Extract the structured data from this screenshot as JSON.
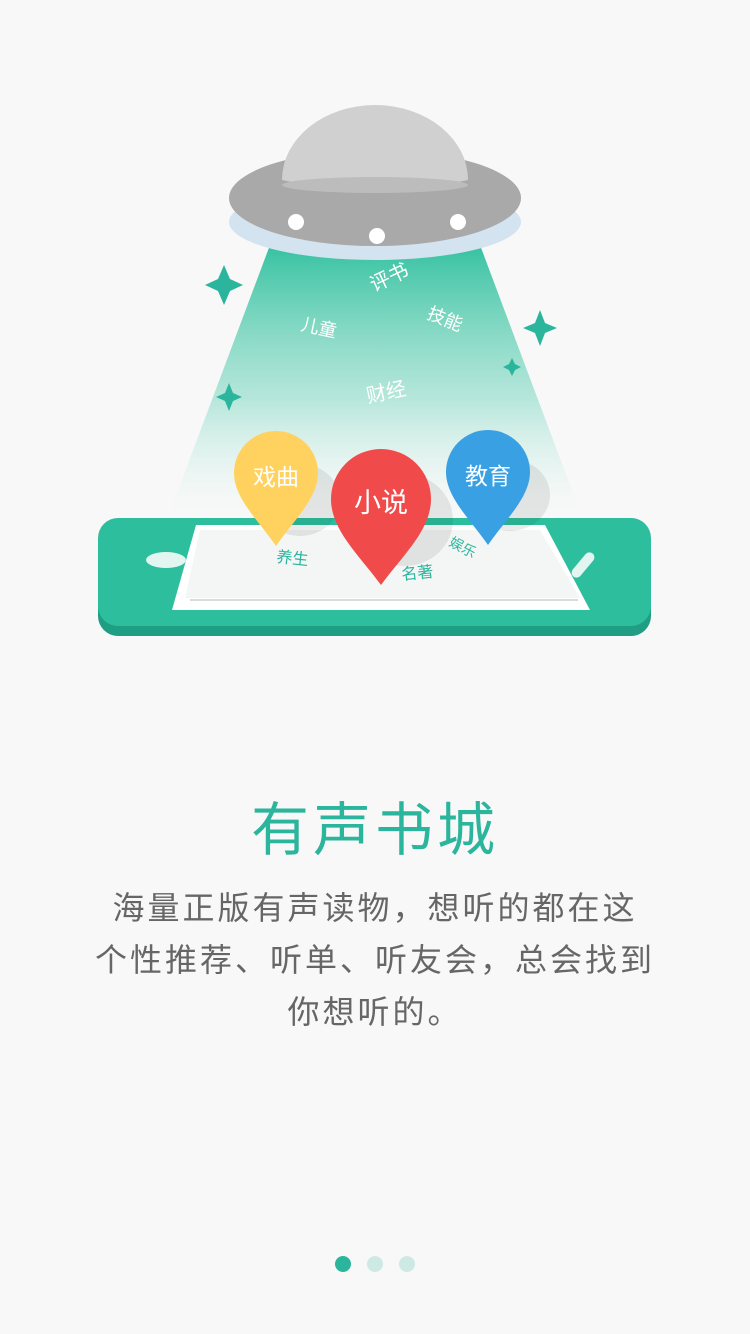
{
  "illustration": {
    "floating_labels": [
      "评书",
      "儿童",
      "技能",
      "财经"
    ],
    "phone_labels": [
      "养生",
      "名著",
      "娱乐"
    ],
    "pins": [
      {
        "label": "戏曲",
        "color": "#ffd25f"
      },
      {
        "label": "小说",
        "color": "#f14a4a"
      },
      {
        "label": "教育",
        "color": "#3aa0e4"
      }
    ]
  },
  "feature": {
    "title": "有声书城",
    "description_lines": [
      "海量正版有声读物，想听的都在这",
      "个性推荐、听单、听友会，总会找到",
      "你想听的。"
    ]
  },
  "pager": {
    "total": 3,
    "active_index": 0
  },
  "colors": {
    "accent": "#2bb59c",
    "text": "#666666",
    "background": "#f8f8f8"
  }
}
